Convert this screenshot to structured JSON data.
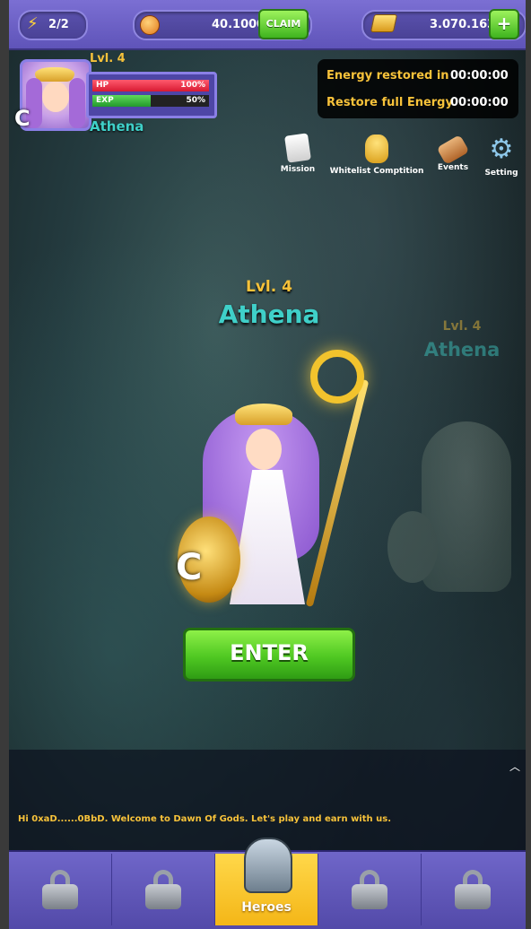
{
  "topbar": {
    "energy": "2/2",
    "coin_balance": "40.1000",
    "claim_label": "CLAIM",
    "gold_balance": "3.070.1637",
    "add_label": "+"
  },
  "profile": {
    "level": "Lvl. 4",
    "name": "Athena",
    "rank_badge": "C",
    "hp_label": "HP",
    "hp_value": "100%",
    "hp_fraction": 1.0,
    "exp_label": "EXP",
    "exp_value": "50%",
    "exp_fraction": 0.5
  },
  "energy_timer": {
    "restored_label": "Energy restored in",
    "restored_value": "00:00:00",
    "full_label": "Restore full Energy",
    "full_value": "00:00:00"
  },
  "menu": [
    {
      "label": "Mission",
      "icon": "scroll-icon"
    },
    {
      "label": "Whitelist Comptition",
      "icon": "trophy-icon"
    },
    {
      "label": "Events",
      "icon": "map-scroll-icon"
    },
    {
      "label": "Setting",
      "icon": "gear-icon"
    }
  ],
  "hero_main": {
    "level": "Lvl. 4",
    "name": "Athena",
    "rank_badge": "C"
  },
  "hero_side": {
    "level": "Lvl. 4",
    "name": "Athena"
  },
  "enter_label": "ENTER",
  "chat": {
    "collapse_icon": "chevron-up-icon",
    "user": "Hi 0xaD......0BbD.",
    "message": "Welcome to Dawn Of Gods. Let's play and earn with us."
  },
  "bottom_nav": {
    "active_label": "Heroes",
    "tabs": [
      "lock-icon",
      "lock-icon",
      "helmet-icon",
      "lock-icon",
      "lock-icon"
    ]
  },
  "colors": {
    "accent_purple": "#6b61c4",
    "gold_text": "#f7c23a",
    "teal_name": "#3fd0c9",
    "hp_red": "#e8283f",
    "exp_green": "#2fb53a",
    "active_tab": "#ffd84a"
  }
}
